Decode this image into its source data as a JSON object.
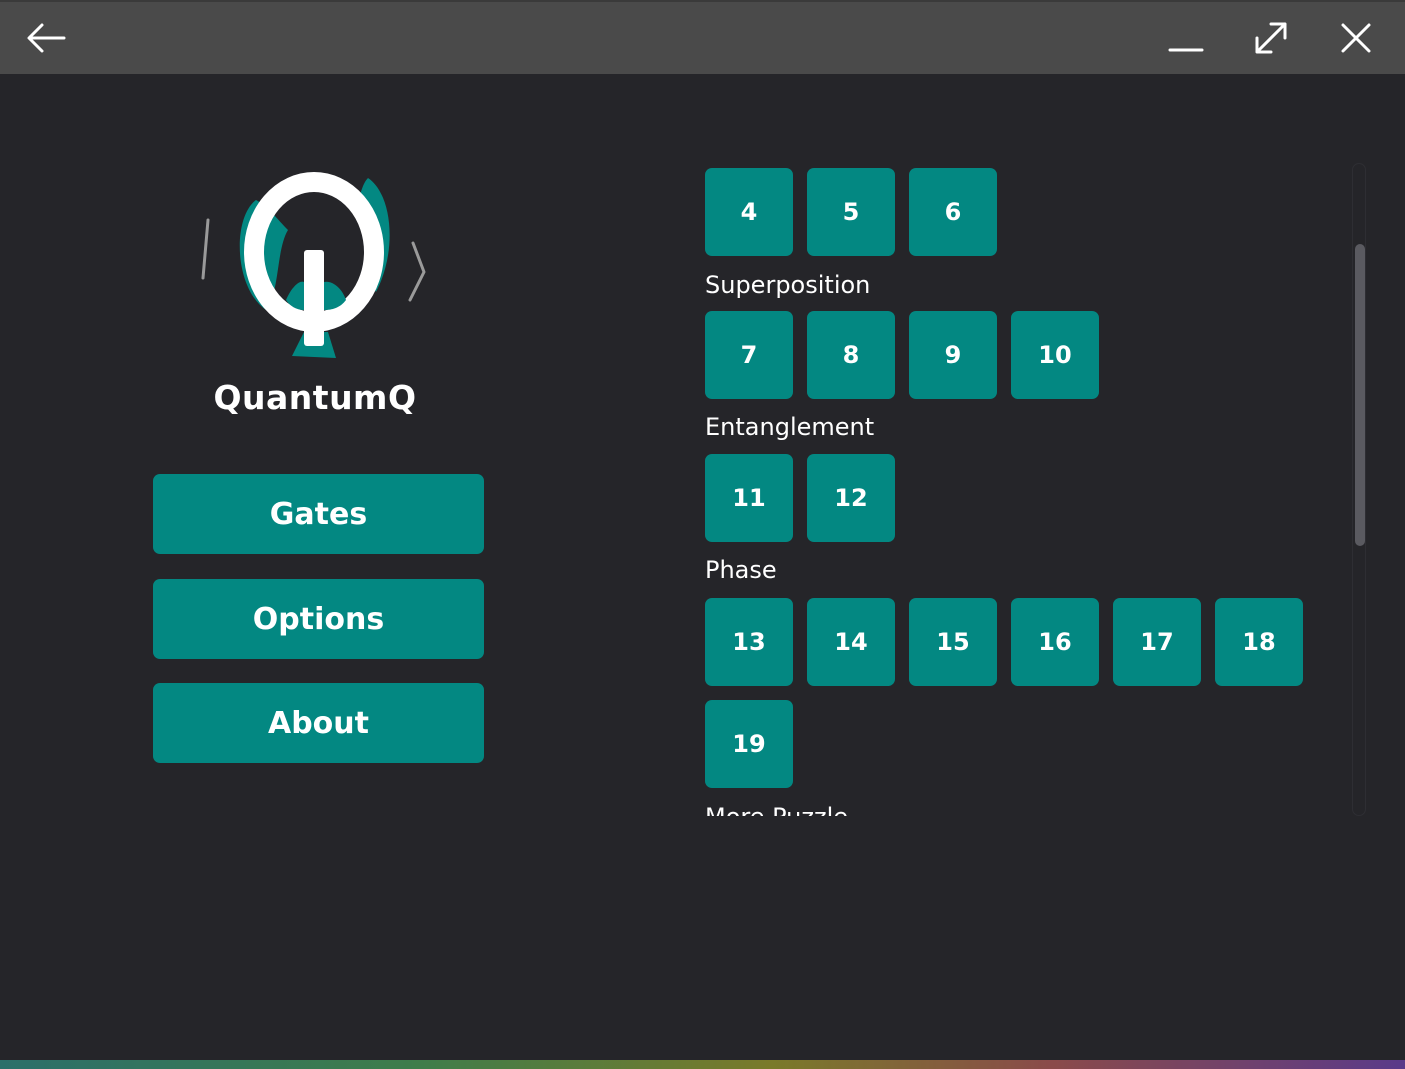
{
  "window": {
    "back_icon": "arrow-left-icon",
    "minimize_icon": "minimize-icon",
    "maximize_icon": "maximize-icon",
    "close_icon": "close-icon"
  },
  "app": {
    "title": "QuantumQ",
    "logo_icon": "quantumq-logo",
    "accent_color": "#038882"
  },
  "menu": {
    "gates_label": "Gates",
    "options_label": "Options",
    "about_label": "About"
  },
  "levels": {
    "row_intro": [
      "4",
      "5",
      "6"
    ],
    "superposition": {
      "label": "Superposition",
      "items": [
        "7",
        "8",
        "9",
        "10"
      ]
    },
    "entanglement": {
      "label": "Entanglement",
      "items": [
        "11",
        "12"
      ]
    },
    "phase": {
      "label": "Phase",
      "items": [
        "13",
        "14",
        "15",
        "16",
        "17",
        "18",
        "19"
      ]
    },
    "more_puzzle": {
      "label": "More Puzzle"
    }
  }
}
